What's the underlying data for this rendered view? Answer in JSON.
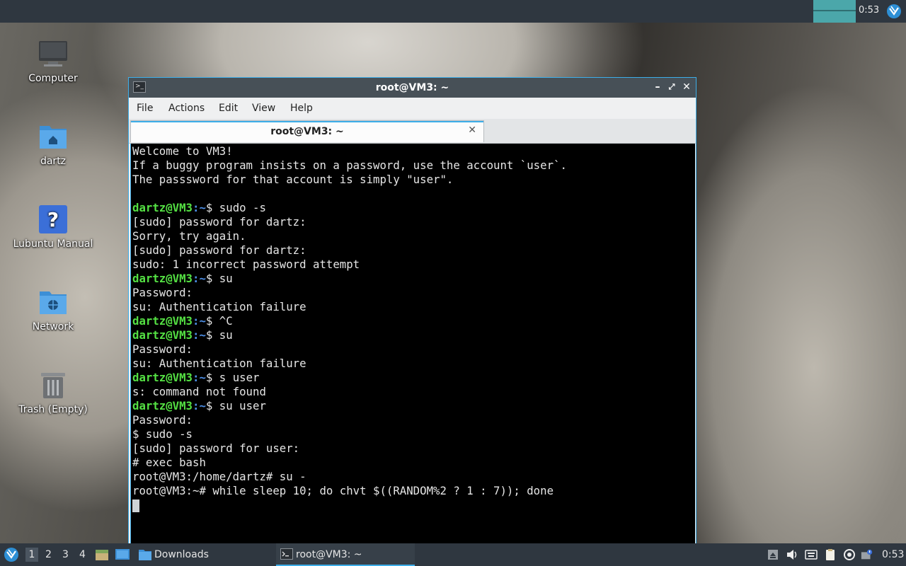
{
  "top_panel": {
    "clock": "0:53",
    "menu_icon": "lubuntu-logo-icon"
  },
  "desktop": {
    "icons": [
      {
        "label": "Computer",
        "icon": "computer-icon"
      },
      {
        "label": "dartz",
        "icon": "home-folder-icon"
      },
      {
        "label": "Lubuntu Manual",
        "icon": "help-icon"
      },
      {
        "label": "Network",
        "icon": "network-folder-icon"
      },
      {
        "label": "Trash (Empty)",
        "icon": "trash-icon"
      }
    ]
  },
  "terminal": {
    "title": "root@VM3: ~",
    "menu": [
      "File",
      "Actions",
      "Edit",
      "View",
      "Help"
    ],
    "tab_label": "root@VM3: ~",
    "lines": [
      {
        "text": "Welcome to VM3!"
      },
      {
        "text": "If a buggy program insists on a password, use the account `user`."
      },
      {
        "text": "The passsword for that account is simply \"user\"."
      },
      {
        "text": ""
      },
      {
        "user": "dartz@VM3",
        "path": "~",
        "cmd": "$ sudo -s"
      },
      {
        "text": "[sudo] password for dartz:"
      },
      {
        "text": "Sorry, try again."
      },
      {
        "text": "[sudo] password for dartz:"
      },
      {
        "text": "sudo: 1 incorrect password attempt"
      },
      {
        "user": "dartz@VM3",
        "path": "~",
        "cmd": "$ su"
      },
      {
        "text": "Password:"
      },
      {
        "text": "su: Authentication failure"
      },
      {
        "user": "dartz@VM3",
        "path": "~",
        "cmd": "$ ^C"
      },
      {
        "user": "dartz@VM3",
        "path": "~",
        "cmd": "$ su"
      },
      {
        "text": "Password:"
      },
      {
        "text": "su: Authentication failure"
      },
      {
        "user": "dartz@VM3",
        "path": "~",
        "cmd": "$ s user"
      },
      {
        "text": "s: command not found"
      },
      {
        "user": "dartz@VM3",
        "path": "~",
        "cmd": "$ su user"
      },
      {
        "text": "Password:"
      },
      {
        "text": "$ sudo -s"
      },
      {
        "text": "[sudo] password for user:"
      },
      {
        "text": "# exec bash"
      },
      {
        "text": "root@VM3:/home/dartz# su -"
      },
      {
        "text": "root@VM3:~# while sleep 10; do chvt $((RANDOM%2 ? 1 : 7)); done"
      }
    ]
  },
  "taskbar": {
    "workspaces": [
      "1",
      "2",
      "3",
      "4"
    ],
    "tasks": [
      {
        "label": "Downloads",
        "icon": "folder-icon"
      },
      {
        "label": "root@VM3: ~",
        "icon": "terminal-icon"
      }
    ],
    "clock": "0:53",
    "tray_icons": [
      "removable-media-icon",
      "volume-icon",
      "keyboard-icon",
      "clipboard-icon",
      "update-icon",
      "network-tray-icon"
    ]
  },
  "colors": {
    "accent": "#3daee9",
    "panel": "#2f3740",
    "prompt_user": "#54e043",
    "prompt_path": "#4d8fe6"
  }
}
